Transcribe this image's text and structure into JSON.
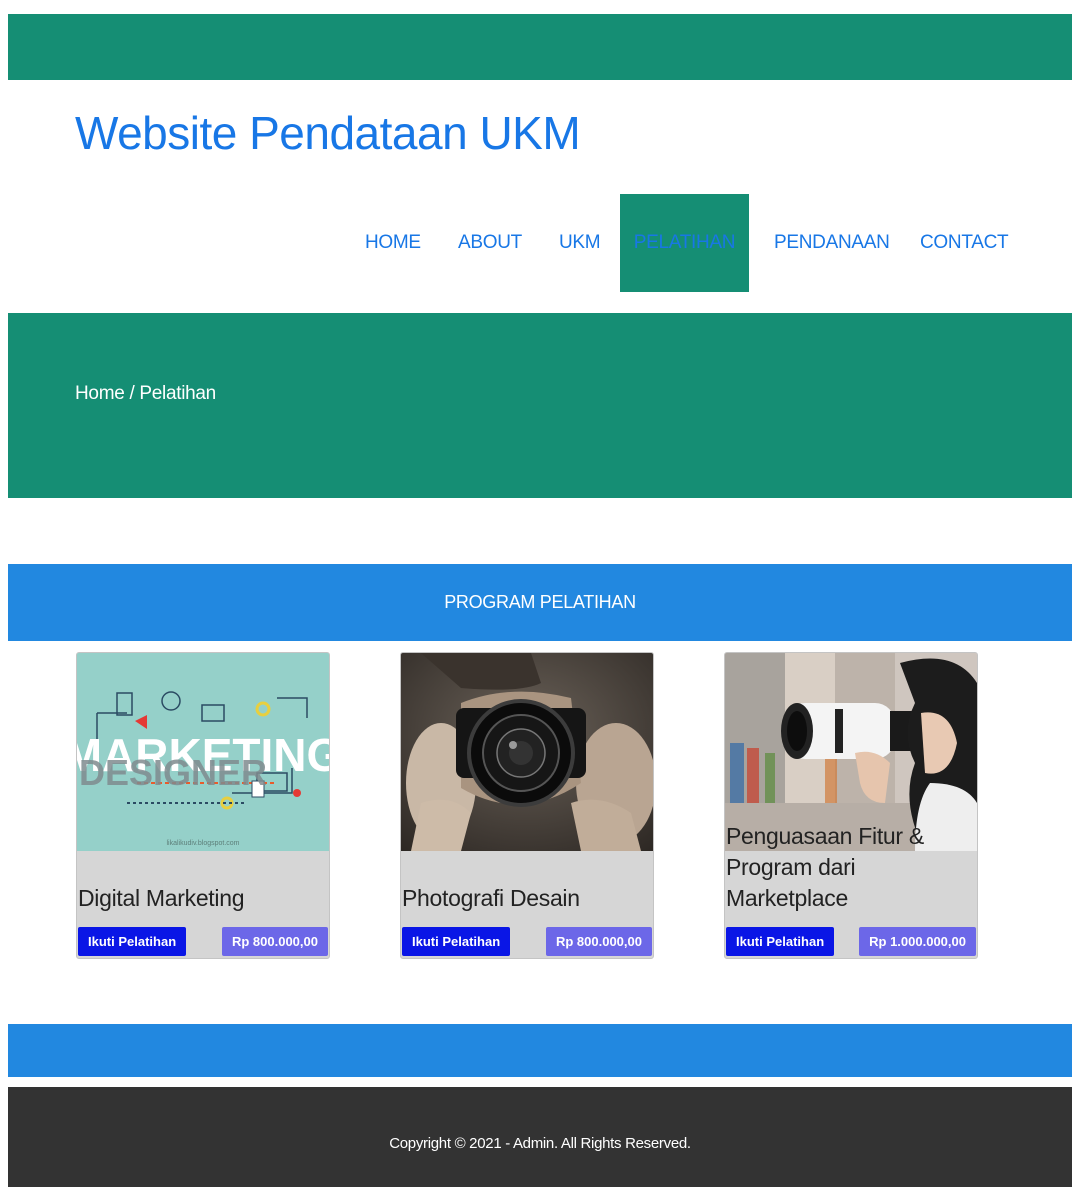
{
  "site": {
    "title": "Website Pendataan UKM"
  },
  "nav": {
    "items": [
      {
        "label": "HOME"
      },
      {
        "label": "ABOUT"
      },
      {
        "label": "UKM"
      },
      {
        "label": "PELATIHAN",
        "active": true
      },
      {
        "label": "PENDANAAN"
      },
      {
        "label": "CONTACT"
      }
    ]
  },
  "breadcrumb": "Home / Pelatihan",
  "program": {
    "title": "PROGRAM PELATIHAN",
    "cards": [
      {
        "image": "marketing-designer-illustration",
        "image_text_1": "MARKETING",
        "image_text_2": "DESIGNER",
        "image_caption": "likalikudiv.blogspot.com",
        "name": "Digital Marketing",
        "button": "Ikuti Pelatihan",
        "price": "Rp 800.000,00"
      },
      {
        "image": "photographer-camera-photo",
        "name": "Photografi Desain",
        "button": "Ikuti Pelatihan",
        "price": "Rp 800.000,00"
      },
      {
        "image": "woman-telephoto-lens-photo",
        "name": "Penguasaan Fitur & Program dari Marketplace",
        "button": "Ikuti Pelatihan",
        "price": "Rp 1.000.000,00"
      }
    ]
  },
  "footer": {
    "copyright": "Copyright © 2021 - Admin. All Rights Reserved."
  },
  "colors": {
    "green": "#158e74",
    "blue_band": "#2288e0",
    "link_blue": "#1877e6",
    "button_blue": "#0a16e6",
    "price_purple": "#6c67e8",
    "footer_dark": "#333333"
  }
}
